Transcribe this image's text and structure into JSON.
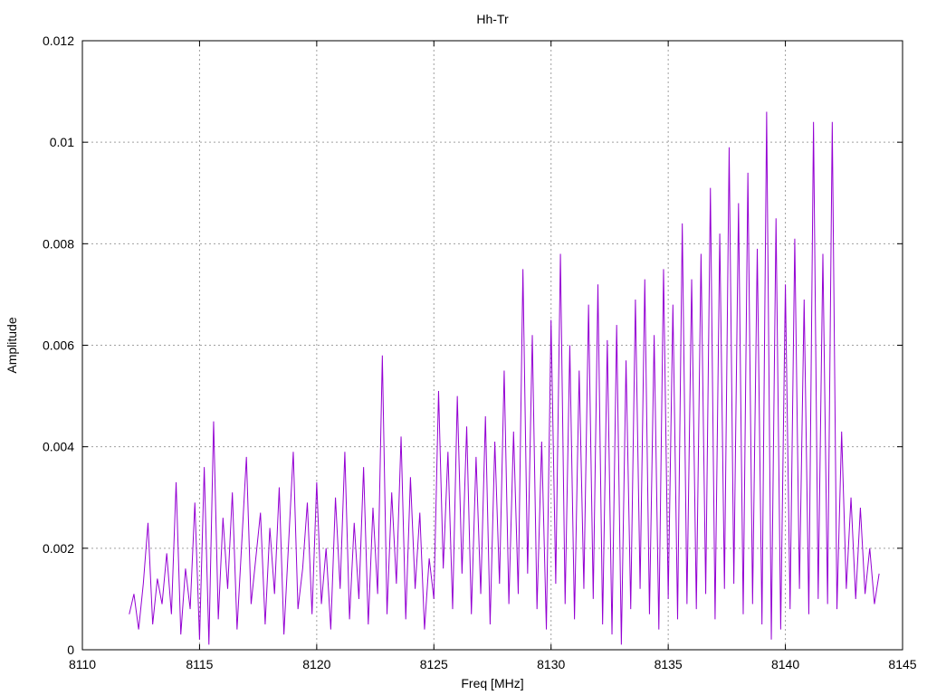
{
  "chart_data": {
    "type": "line",
    "title": "Hh-Tr",
    "xlabel": "Freq [MHz]",
    "ylabel": "Amplitude",
    "xlim": [
      8110,
      8145
    ],
    "ylim": [
      0,
      0.012
    ],
    "x_ticks": [
      "8110",
      "8115",
      "8120",
      "8125",
      "8130",
      "8135",
      "8140",
      "8145"
    ],
    "y_ticks": [
      "0",
      "0.002",
      "0.004",
      "0.006",
      "0.008",
      "0.01",
      "0.012"
    ],
    "grid": true,
    "grid_style": "dotted",
    "line_color": "#9400D3",
    "series": [
      {
        "x": [
          8112.0,
          8112.2,
          8112.4,
          8112.6,
          8112.8,
          8113.0,
          8113.2,
          8113.4,
          8113.6,
          8113.8,
          8114.0,
          8114.2,
          8114.4,
          8114.6,
          8114.8,
          8115.0,
          8115.2,
          8115.4,
          8115.6,
          8115.8,
          8116.0,
          8116.2,
          8116.4,
          8116.6,
          8116.8,
          8117.0,
          8117.2,
          8117.4,
          8117.6,
          8117.8,
          8118.0,
          8118.2,
          8118.4,
          8118.6,
          8118.8,
          8119.0,
          8119.2,
          8119.4,
          8119.6,
          8119.8,
          8120.0,
          8120.2,
          8120.4,
          8120.6,
          8120.8,
          8121.0,
          8121.2,
          8121.4,
          8121.6,
          8121.8,
          8122.0,
          8122.2,
          8122.4,
          8122.6,
          8122.8,
          8123.0,
          8123.2,
          8123.4,
          8123.6,
          8123.8,
          8124.0,
          8124.2,
          8124.4,
          8124.6,
          8124.8,
          8125.0,
          8125.2,
          8125.4,
          8125.6,
          8125.8,
          8126.0,
          8126.2,
          8126.4,
          8126.6,
          8126.8,
          8127.0,
          8127.2,
          8127.4,
          8127.6,
          8127.8,
          8128.0,
          8128.2,
          8128.4,
          8128.6,
          8128.8,
          8129.0,
          8129.2,
          8129.4,
          8129.6,
          8129.8,
          8130.0,
          8130.2,
          8130.4,
          8130.6,
          8130.8,
          8131.0,
          8131.2,
          8131.4,
          8131.6,
          8131.8,
          8132.0,
          8132.2,
          8132.4,
          8132.6,
          8132.8,
          8133.0,
          8133.2,
          8133.4,
          8133.6,
          8133.8,
          8134.0,
          8134.2,
          8134.4,
          8134.6,
          8134.8,
          8135.0,
          8135.2,
          8135.4,
          8135.6,
          8135.8,
          8136.0,
          8136.2,
          8136.4,
          8136.6,
          8136.8,
          8137.0,
          8137.2,
          8137.4,
          8137.6,
          8137.8,
          8138.0,
          8138.2,
          8138.4,
          8138.6,
          8138.8,
          8139.0,
          8139.2,
          8139.4,
          8139.6,
          8139.8,
          8140.0,
          8140.2,
          8140.4,
          8140.6,
          8140.8,
          8141.0,
          8141.2,
          8141.4,
          8141.6,
          8141.8,
          8142.0,
          8142.2,
          8142.4,
          8142.6,
          8142.8,
          8143.0,
          8143.2,
          8143.4,
          8143.6,
          8143.8,
          8144.0
        ],
        "y": [
          0.0007,
          0.0011,
          0.0004,
          0.0013,
          0.0025,
          0.0005,
          0.0014,
          0.0009,
          0.0019,
          0.0007,
          0.0033,
          0.0003,
          0.0016,
          0.0008,
          0.0029,
          0.0002,
          0.0036,
          0.0001,
          0.0045,
          0.0006,
          0.0026,
          0.0012,
          0.0031,
          0.0004,
          0.0021,
          0.0038,
          0.0009,
          0.0018,
          0.0027,
          0.0005,
          0.0024,
          0.0011,
          0.0032,
          0.0003,
          0.0021,
          0.0039,
          0.0008,
          0.0016,
          0.0029,
          0.0007,
          0.0033,
          0.0009,
          0.002,
          0.0004,
          0.003,
          0.0012,
          0.0039,
          0.0006,
          0.0025,
          0.001,
          0.0036,
          0.0005,
          0.0028,
          0.0011,
          0.0058,
          0.0007,
          0.0031,
          0.0013,
          0.0042,
          0.0006,
          0.0034,
          0.0012,
          0.0027,
          0.0004,
          0.0018,
          0.001,
          0.0051,
          0.0016,
          0.0039,
          0.0008,
          0.005,
          0.0015,
          0.0044,
          0.0007,
          0.0038,
          0.0011,
          0.0046,
          0.0005,
          0.0041,
          0.0013,
          0.0055,
          0.0009,
          0.0043,
          0.0011,
          0.0075,
          0.0015,
          0.0062,
          0.0008,
          0.0041,
          0.0004,
          0.0065,
          0.0013,
          0.0078,
          0.0009,
          0.006,
          0.0006,
          0.0055,
          0.0012,
          0.0068,
          0.001,
          0.0072,
          0.0005,
          0.0061,
          0.0003,
          0.0064,
          0.0001,
          0.0057,
          0.0008,
          0.0069,
          0.0012,
          0.0073,
          0.0007,
          0.0062,
          0.0004,
          0.0075,
          0.001,
          0.0068,
          0.0006,
          0.0084,
          0.0009,
          0.0073,
          0.0008,
          0.0078,
          0.0011,
          0.0091,
          0.0006,
          0.0082,
          0.0012,
          0.0099,
          0.0013,
          0.0088,
          0.0007,
          0.0094,
          0.0009,
          0.0079,
          0.0005,
          0.0106,
          0.0002,
          0.0085,
          0.0004,
          0.0072,
          0.0008,
          0.0081,
          0.0012,
          0.0069,
          0.0007,
          0.0104,
          0.001,
          0.0078,
          0.0009,
          0.0104,
          0.0008,
          0.0043,
          0.0012,
          0.003,
          0.001,
          0.0028,
          0.0011,
          0.002,
          0.0009,
          0.0015
        ]
      }
    ]
  }
}
